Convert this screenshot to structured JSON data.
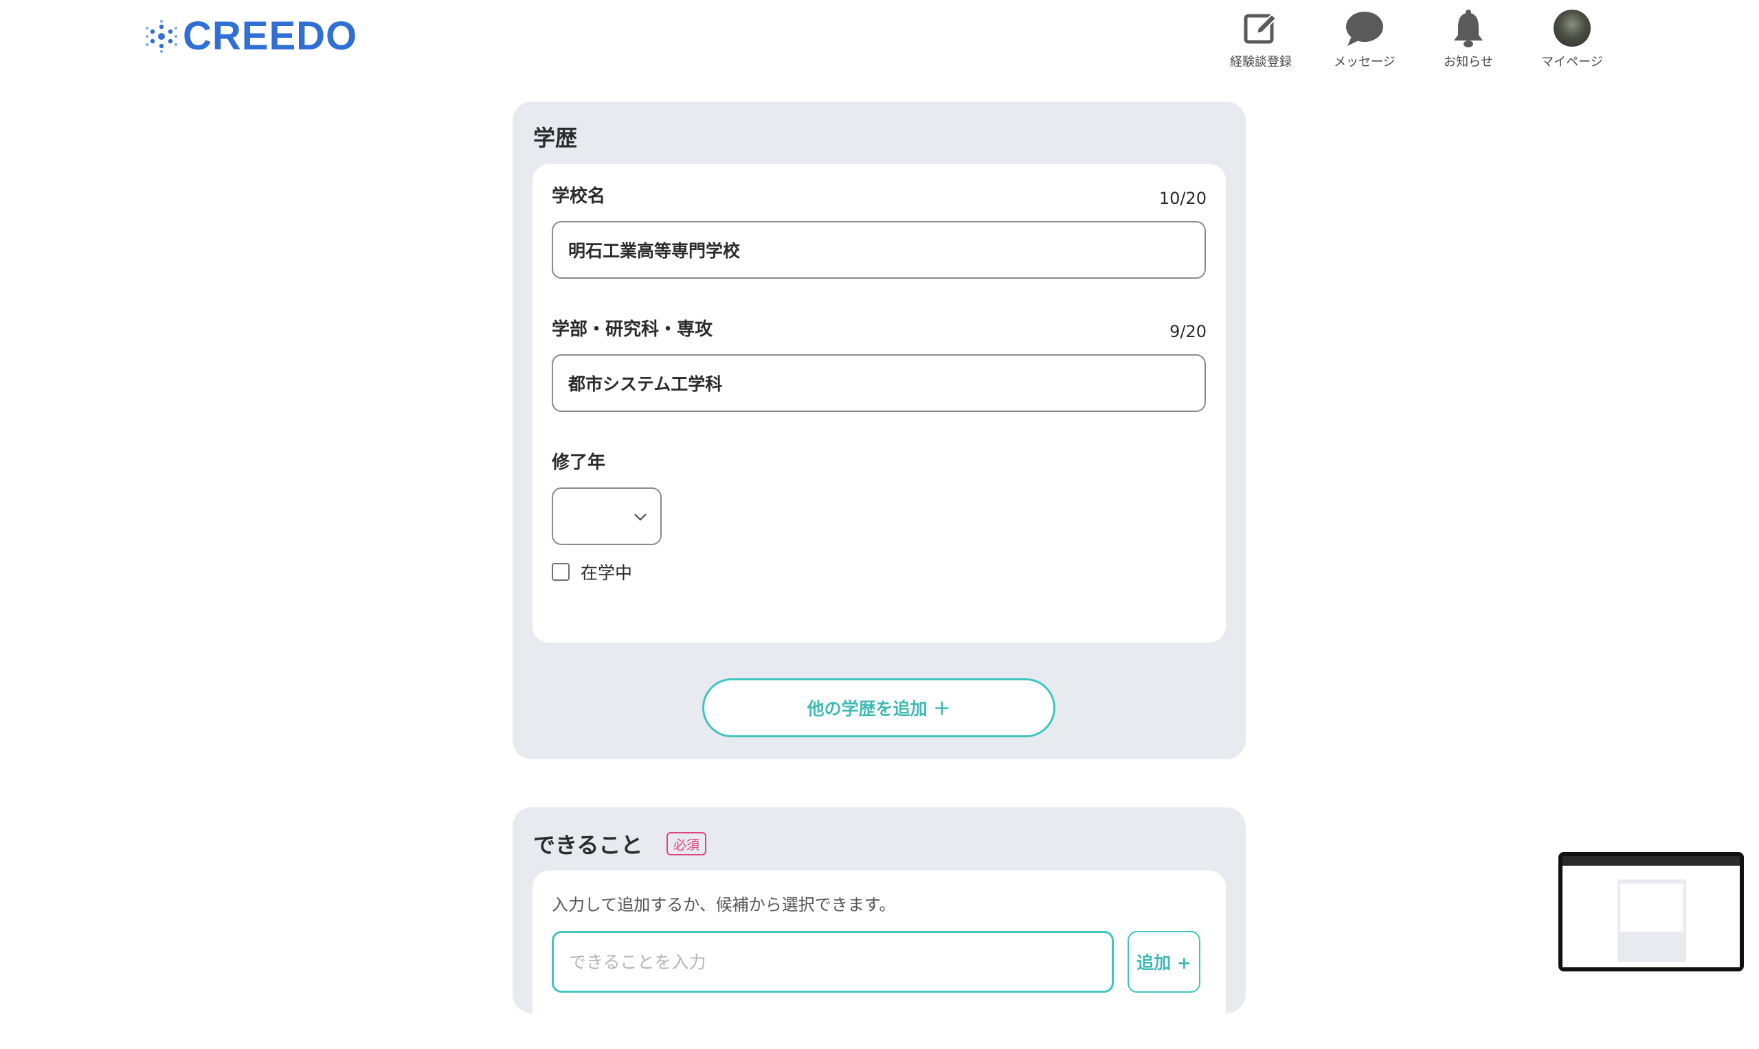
{
  "header": {
    "logo_text": "CREEDO",
    "nav": [
      {
        "label": "経験談登録",
        "icon": "edit-icon"
      },
      {
        "label": "メッセージ",
        "icon": "chat-bubble-icon"
      },
      {
        "label": "お知らせ",
        "icon": "bell-icon"
      },
      {
        "label": "マイページ",
        "icon": "avatar"
      }
    ]
  },
  "education": {
    "title": "学歴",
    "school_name": {
      "label": "学校名",
      "counter": "10/20",
      "value": "明石工業高等専門学校"
    },
    "department": {
      "label": "学部・研究科・専攻",
      "counter": "9/20",
      "value": "都市システム工学科"
    },
    "graduation_year": {
      "label": "修了年",
      "value": ""
    },
    "enrolled": {
      "label": "在学中",
      "checked": false
    },
    "add_button": "他の学歴を追加 ＋"
  },
  "skills": {
    "title": "できること",
    "required_badge": "必須",
    "hint": "入力して追加するか、候補から選択できます。",
    "input_placeholder": "できることを入力",
    "add_button": "追加 +"
  },
  "colors": {
    "brand": "#2f6fd6",
    "accent": "#3fc4be",
    "required": "#e0457b",
    "section_bg": "#e7ebef"
  }
}
